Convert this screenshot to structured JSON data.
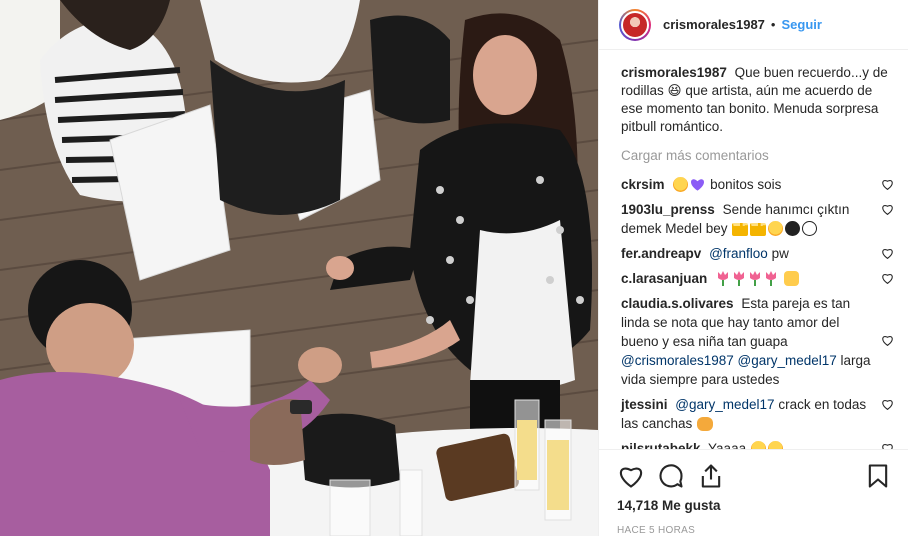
{
  "post": {
    "author": "crismorales1987",
    "separator": "•",
    "follow_label": "Seguir",
    "caption": {
      "user": "crismorales1987",
      "text": "Que buen recuerdo...y de rodillas 😆 que artista, aún me acuerdo de ese momento tan bonito. Menuda sorpresa pitbull romántico."
    },
    "load_more_label": "Cargar más comentarios",
    "comments": [
      {
        "user": "ckrsim",
        "text": "bonitos sois"
      },
      {
        "user": "1903lu_prenss",
        "text": "Sende hanımcı çıktın demek Medel bey"
      },
      {
        "user": "fer.andreapv",
        "mention": "@franfloo",
        "text": "pw"
      },
      {
        "user": "c.larasanjuan",
        "text": ""
      },
      {
        "user": "claudia.s.olivares",
        "text": "Esta pareja es tan linda se nota que hay tanto amor del bueno y esa niña tan guapa",
        "mentions": [
          "@crismorales1987",
          "@gary_medel17"
        ],
        "text2": "larga vida siempre para ustedes"
      },
      {
        "user": "jtessini",
        "mention": "@gary_medel17",
        "text": "crack en todas las canchas"
      },
      {
        "user": "pilsrutabekk",
        "text": "Yaaaa"
      }
    ],
    "likes_label": "14,718 Me gusta",
    "time_label": "HACE 5 HORAS"
  },
  "icons": {
    "like": "heart-icon",
    "comment": "comment-icon",
    "share": "share-icon",
    "save": "bookmark-icon",
    "comment_like": "small-heart-icon"
  },
  "colors": {
    "link": "#3897f0",
    "text": "#262626",
    "muted": "#999999",
    "mention": "#003569"
  }
}
